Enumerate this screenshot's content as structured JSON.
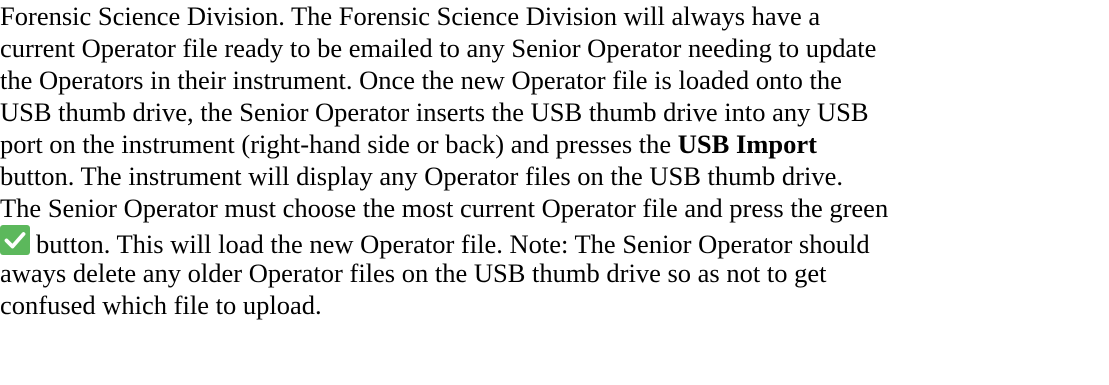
{
  "document": {
    "lines": [
      "Forensic Science Division.  The Forensic Science Division will always have a",
      "current Operator file ready to be emailed to any Senior Operator needing to update",
      "the Operators in their instrument.  Once the new Operator file is loaded onto the",
      "USB thumb drive, the Senior Operator inserts the USB thumb drive into any USB",
      "port on the instrument (right-hand side or back) and presses the "
    ],
    "usb_import_bold": "USB Import",
    "line6": "button.  The instrument will display any Operator files on the USB thumb drive.",
    "line7": "The Senior Operator must choose the most current Operator file and press the green",
    "line8_after_icon": "button.  This will load the new Operator file.  Note: The Senior Operator should",
    "line9": "aways delete any older Operator files on the USB thumb drive so as not to get",
    "line10": "confused which file to upload.",
    "icon": "green-checkmark-icon",
    "icon_color": "#5cb85c"
  }
}
